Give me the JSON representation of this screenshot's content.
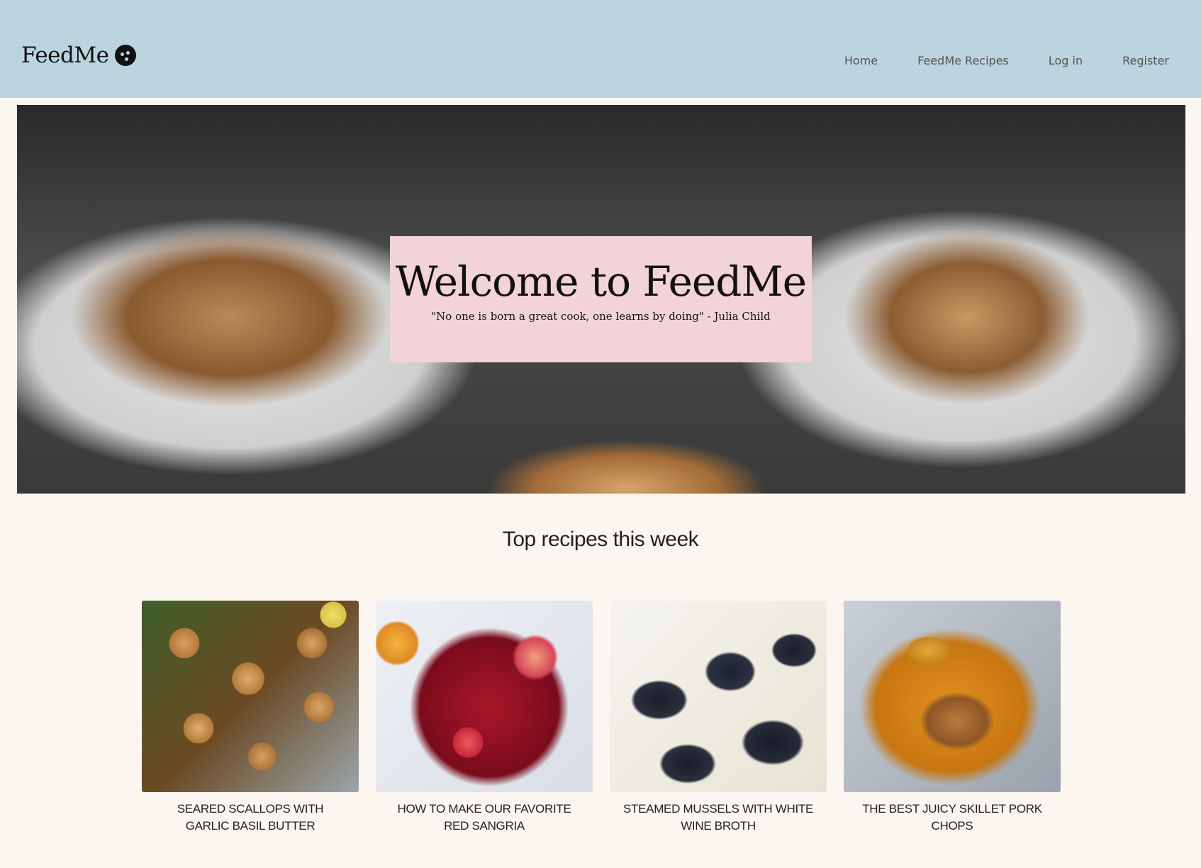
{
  "header": {
    "brand": "FeedMe",
    "brand_icon": "smiley-face-icon",
    "nav": [
      "Home",
      "FeedMe Recipes",
      "Log in",
      "Register"
    ],
    "background": "#bcd4de"
  },
  "hero": {
    "title": "Welcome to FeedMe",
    "quote": "\"No one is born a great cook, one learns by doing\" - Julia Child",
    "box_color": "#f2d3d8"
  },
  "recipes": {
    "title": "Top recipes this week",
    "items": [
      {
        "caption": "SEARED SCALLOPS WITH GARLIC BASIL BUTTER"
      },
      {
        "caption": "HOW TO MAKE OUR FAVORITE RED SANGRIA"
      },
      {
        "caption": "STEAMED MUSSELS WITH WHITE WINE BROTH"
      },
      {
        "caption": "THE BEST JUICY SKILLET PORK CHOPS"
      }
    ]
  }
}
